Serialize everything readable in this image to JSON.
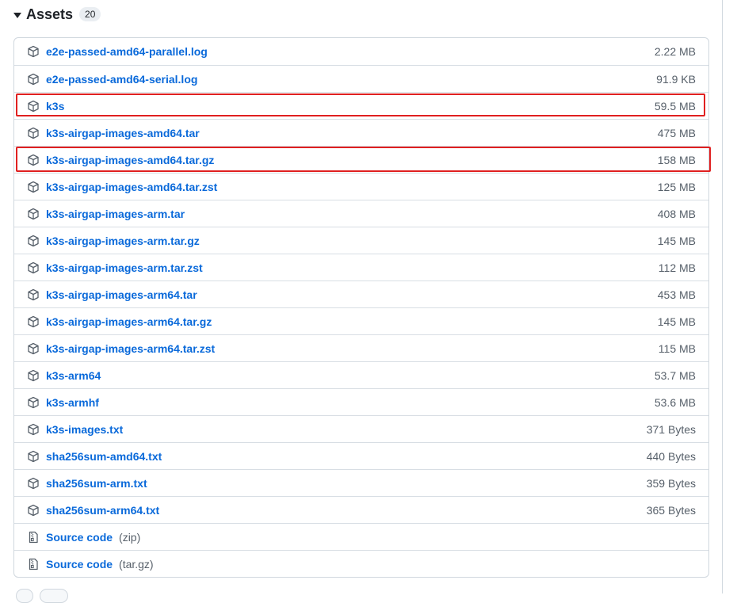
{
  "header": {
    "title": "Assets",
    "count": "20"
  },
  "assets": [
    {
      "name": "e2e-passed-amd64-parallel.log",
      "size": "2.22 MB"
    },
    {
      "name": "e2e-passed-amd64-serial.log",
      "size": "91.9 KB"
    },
    {
      "name": "k3s",
      "size": "59.5 MB"
    },
    {
      "name": "k3s-airgap-images-amd64.tar",
      "size": "475 MB"
    },
    {
      "name": "k3s-airgap-images-amd64.tar.gz",
      "size": "158 MB"
    },
    {
      "name": "k3s-airgap-images-amd64.tar.zst",
      "size": "125 MB"
    },
    {
      "name": "k3s-airgap-images-arm.tar",
      "size": "408 MB"
    },
    {
      "name": "k3s-airgap-images-arm.tar.gz",
      "size": "145 MB"
    },
    {
      "name": "k3s-airgap-images-arm.tar.zst",
      "size": "112 MB"
    },
    {
      "name": "k3s-airgap-images-arm64.tar",
      "size": "453 MB"
    },
    {
      "name": "k3s-airgap-images-arm64.tar.gz",
      "size": "145 MB"
    },
    {
      "name": "k3s-airgap-images-arm64.tar.zst",
      "size": "115 MB"
    },
    {
      "name": "k3s-arm64",
      "size": "53.7 MB"
    },
    {
      "name": "k3s-armhf",
      "size": "53.6 MB"
    },
    {
      "name": "k3s-images.txt",
      "size": "371 Bytes"
    },
    {
      "name": "sha256sum-amd64.txt",
      "size": "440 Bytes"
    },
    {
      "name": "sha256sum-arm.txt",
      "size": "359 Bytes"
    },
    {
      "name": "sha256sum-arm64.txt",
      "size": "365 Bytes"
    }
  ],
  "source": [
    {
      "label": "Source code",
      "format": "(zip)"
    },
    {
      "label": "Source code",
      "format": "(tar.gz)"
    }
  ],
  "colors": {
    "link": "#0969da",
    "highlight": "#e02020"
  },
  "icons": {
    "asset": "package-icon",
    "source": "file-zip-icon"
  }
}
